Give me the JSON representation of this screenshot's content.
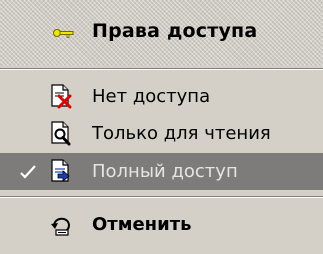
{
  "menu": {
    "header": {
      "title": "Права доступа",
      "icon": "key-icon"
    },
    "items": [
      {
        "label": "Нет доступа",
        "icon": "no-access-icon",
        "checked": false
      },
      {
        "label": "Только для чтения",
        "icon": "read-only-icon",
        "checked": false
      },
      {
        "label": "Полный доступ",
        "icon": "full-access-icon",
        "checked": true
      }
    ],
    "cancel": {
      "label": "Отменить",
      "icon": "undo-icon"
    }
  }
}
